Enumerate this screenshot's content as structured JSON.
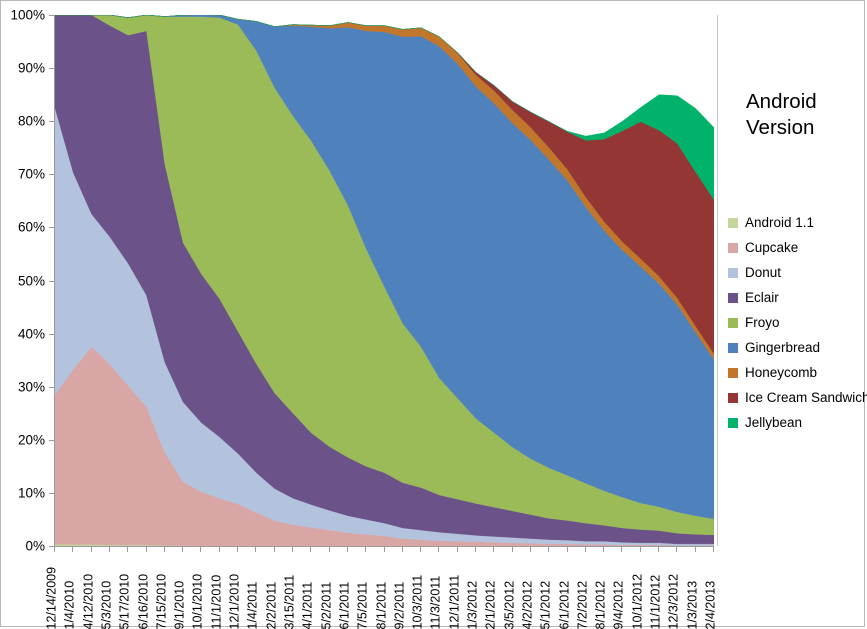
{
  "chart_data": {
    "type": "area",
    "stacked": true,
    "normalized_percent": true,
    "title": "",
    "xlabel": "",
    "ylabel": "",
    "ylim": [
      0,
      100
    ],
    "ytick_labels": [
      "0%",
      "10%",
      "20%",
      "30%",
      "40%",
      "50%",
      "60%",
      "70%",
      "80%",
      "90%",
      "100%"
    ],
    "ytick_values": [
      0,
      10,
      20,
      30,
      40,
      50,
      60,
      70,
      80,
      90,
      100
    ],
    "grid": false,
    "legend_position": "right",
    "legend_title": "Android Version",
    "categories": [
      "12/14/2009",
      "1/4/2010",
      "4/12/2010",
      "5/3/2010",
      "5/17/2010",
      "6/16/2010",
      "7/15/2010",
      "9/1/2010",
      "10/1/2010",
      "11/1/2010",
      "12/1/2010",
      "1/4/2011",
      "2/2/2011",
      "3/15/2011",
      "4/1/2011",
      "5/2/2011",
      "6/1/2011",
      "7/5/2011",
      "8/1/2011",
      "9/2/2011",
      "10/3/2011",
      "11/3/2011",
      "12/1/2011",
      "1/3/2012",
      "2/1/2012",
      "3/5/2012",
      "4/2/2012",
      "5/1/2012",
      "6/1/2012",
      "7/2/2012",
      "8/1/2012",
      "9/4/2012",
      "10/1/2012",
      "11/1/2012",
      "12/3/2012",
      "1/3/2013",
      "2/4/2013"
    ],
    "series": [
      {
        "name": "Android 1.1",
        "color": "#c3d69b",
        "values": [
          0.3,
          0.3,
          0.3,
          0.2,
          0.2,
          0.2,
          0.1,
          0.1,
          0.0,
          0.0,
          0.0,
          0.0,
          0.0,
          0.0,
          0.0,
          0.0,
          0.0,
          0.0,
          0.0,
          0.0,
          0.0,
          0.0,
          0.0,
          0.0,
          0.0,
          0.0,
          0.0,
          0.0,
          0.0,
          0.0,
          0.0,
          0.0,
          0.0,
          0.0,
          0.0,
          0.0,
          0.0
        ]
      },
      {
        "name": "Cupcake",
        "color": "#d9a6a6",
        "values": [
          28.2,
          33.0,
          37.2,
          34.0,
          30.0,
          26.0,
          17.5,
          12.0,
          10.2,
          9.0,
          7.9,
          6.3,
          4.8,
          4.0,
          3.5,
          3.0,
          2.5,
          2.2,
          1.9,
          1.4,
          1.2,
          1.0,
          0.9,
          0.8,
          0.7,
          0.6,
          0.5,
          0.4,
          0.4,
          0.3,
          0.3,
          0.2,
          0.2,
          0.2,
          0.1,
          0.1,
          0.1
        ]
      },
      {
        "name": "Donut",
        "color": "#b3c3de",
        "values": [
          54.0,
          37.0,
          25.0,
          24.0,
          23.0,
          21.0,
          17.0,
          15.0,
          13.0,
          11.5,
          9.5,
          7.5,
          6.0,
          5.0,
          4.3,
          3.7,
          3.2,
          2.8,
          2.4,
          2.0,
          1.8,
          1.6,
          1.4,
          1.2,
          1.1,
          1.0,
          0.9,
          0.8,
          0.7,
          0.6,
          0.6,
          0.5,
          0.4,
          0.4,
          0.3,
          0.3,
          0.3
        ]
      },
      {
        "name": "Eclair",
        "color": "#6b5288",
        "values": [
          17.5,
          29.7,
          37.5,
          39.8,
          43.0,
          49.8,
          37.3,
          30.0,
          28.0,
          26.0,
          23.0,
          20.5,
          18.0,
          16.0,
          13.5,
          12.0,
          11.0,
          10.0,
          9.5,
          8.5,
          8.0,
          7.0,
          6.5,
          6.0,
          5.5,
          5.0,
          4.5,
          4.0,
          3.7,
          3.4,
          3.0,
          2.7,
          2.5,
          2.3,
          2.0,
          1.8,
          1.7
        ]
      },
      {
        "name": "Froyo",
        "color": "#9bbb59",
        "values": [
          0.0,
          0.0,
          0.0,
          2.0,
          3.3,
          3.0,
          27.8,
          42.6,
          48.5,
          53.0,
          57.8,
          59.0,
          57.5,
          56.0,
          55.0,
          52.0,
          47.5,
          41.0,
          35.0,
          30.0,
          26.5,
          22.0,
          19.0,
          16.0,
          14.0,
          12.0,
          10.5,
          9.5,
          8.5,
          7.5,
          6.5,
          5.8,
          5.0,
          4.5,
          4.0,
          3.5,
          3.0
        ]
      },
      {
        "name": "Gingerbread",
        "color": "#4f81bd",
        "values": [
          0.0,
          0.0,
          0.0,
          0.0,
          0.0,
          0.0,
          0.0,
          0.3,
          0.4,
          0.5,
          1.0,
          5.5,
          11.5,
          17.0,
          21.5,
          26.8,
          33.5,
          41.0,
          48.0,
          54.0,
          58.5,
          62.5,
          63.0,
          62.5,
          62.0,
          61.0,
          60.0,
          58.0,
          55.5,
          52.0,
          49.0,
          46.5,
          44.5,
          42.0,
          39.0,
          34.5,
          30.0
        ]
      },
      {
        "name": "Honeycomb",
        "color": "#c0762b",
        "values": [
          0.0,
          0.0,
          0.0,
          0.0,
          0.0,
          0.0,
          0.0,
          0.0,
          0.0,
          0.0,
          0.0,
          0.0,
          0.0,
          0.2,
          0.3,
          0.5,
          0.9,
          1.0,
          1.2,
          1.4,
          1.6,
          1.8,
          2.0,
          2.2,
          2.4,
          2.5,
          2.4,
          2.3,
          2.1,
          1.9,
          1.7,
          1.6,
          1.5,
          1.4,
          1.3,
          1.2,
          1.1
        ]
      },
      {
        "name": "Ice Cream Sandwich",
        "color": "#943634",
        "values": [
          0.0,
          0.0,
          0.0,
          0.0,
          0.0,
          0.0,
          0.0,
          0.0,
          0.0,
          0.0,
          0.0,
          0.0,
          0.0,
          0.0,
          0.0,
          0.0,
          0.0,
          0.0,
          0.0,
          0.0,
          0.0,
          0.0,
          0.1,
          0.5,
          1.0,
          1.6,
          2.9,
          4.9,
          7.1,
          10.7,
          15.5,
          20.9,
          25.8,
          27.5,
          29.1,
          29.0,
          29.0
        ]
      },
      {
        "name": "Jellybean",
        "color": "#00b playful"
      }
    ],
    "series_jellybean": {
      "name": "Jellybean",
      "color": "#00b26a",
      "values": [
        0.0,
        0.0,
        0.0,
        0.0,
        0.0,
        0.0,
        0.0,
        0.0,
        0.0,
        0.0,
        0.0,
        0.0,
        0.0,
        0.0,
        0.0,
        0.0,
        0.0,
        0.0,
        0.0,
        0.0,
        0.0,
        0.0,
        0.0,
        0.0,
        0.0,
        0.0,
        0.0,
        0.0,
        0.1,
        0.8,
        1.2,
        1.8,
        2.7,
        6.7,
        9.0,
        12.0,
        13.6
      ]
    }
  },
  "legend": {
    "title_line1": "Android",
    "title_line2": "Version",
    "items": [
      {
        "label": "Android 1.1",
        "color": "#c3d69b"
      },
      {
        "label": "Cupcake",
        "color": "#d9a6a6"
      },
      {
        "label": "Donut",
        "color": "#b3c3de"
      },
      {
        "label": "Eclair",
        "color": "#6b5288"
      },
      {
        "label": "Froyo",
        "color": "#9bbb59"
      },
      {
        "label": "Gingerbread",
        "color": "#4f81bd"
      },
      {
        "label": "Honeycomb",
        "color": "#c0762b"
      },
      {
        "label": "Ice Cream Sandwich",
        "color": "#943634"
      },
      {
        "label": "Jellybean",
        "color": "#00b26a"
      }
    ]
  }
}
